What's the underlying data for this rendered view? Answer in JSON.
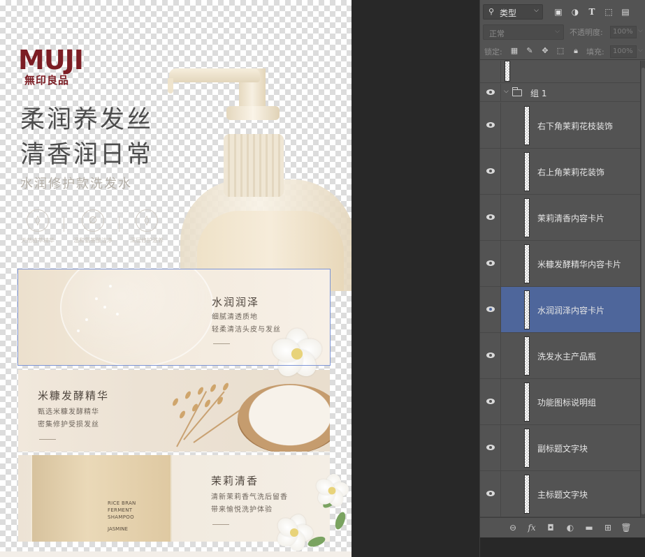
{
  "poster": {
    "logo": {
      "main": "MUJI",
      "sub": "無印良品"
    },
    "headline": {
      "line1": "柔润养发丝",
      "line2": "清香润日常"
    },
    "subtitle": "水润修护款洗发水",
    "features": [
      {
        "icon": "droplet-icon",
        "glyph": "◊",
        "label": "天然植萃精华"
      },
      {
        "icon": "leaf-icon",
        "glyph": "∅",
        "label": "温和氨基酸洁净"
      },
      {
        "icon": "water-drop-icon",
        "glyph": "◊",
        "label": "深层修护滋养"
      }
    ],
    "cards": [
      {
        "title": "水润润泽",
        "desc1": "细腻清透质地",
        "desc2": "轻柔清洁头皮与发丝"
      },
      {
        "title": "米糠发酵精华",
        "desc1": "甄选米糠发酵精华",
        "desc2": "密集修护受损发丝"
      },
      {
        "title": "茉莉清香",
        "desc1": "清新茉莉香气洗后留香",
        "desc2": "带来愉悦洗护体验"
      }
    ],
    "bottle_label": {
      "lines": [
        "RICE BRAN",
        "FERMENT",
        "SHAMPOO"
      ],
      "variant": "JASMINE"
    },
    "colors": {
      "brand": "#7c1d24",
      "selection": "#7d95d6"
    }
  },
  "layers_panel": {
    "filter": {
      "label": "类型",
      "icon": "search-icon"
    },
    "filter_icons": [
      "image-filter-icon",
      "adjustment-filter-icon",
      "type-filter-icon",
      "shape-filter-icon",
      "smart-object-filter-icon"
    ],
    "blend_mode": "正常",
    "opacity": {
      "label": "不透明度:",
      "value": "100%"
    },
    "lock": {
      "label": "锁定:"
    },
    "fill": {
      "label": "填充:",
      "value": "100%"
    },
    "group": {
      "name": "组 1"
    },
    "layers": [
      {
        "name": "右下角茉莉花枝装饰",
        "selected": false
      },
      {
        "name": "右上角茉莉花装饰",
        "selected": false
      },
      {
        "name": "茉莉清香内容卡片",
        "selected": false
      },
      {
        "name": "米糠发酵精华内容卡片",
        "selected": false
      },
      {
        "name": "水润润泽内容卡片",
        "selected": true
      },
      {
        "name": "洗发水主产品瓶",
        "selected": false
      },
      {
        "name": "功能图标说明组",
        "selected": false
      },
      {
        "name": "副标题文字块",
        "selected": false
      },
      {
        "name": "主标题文字块",
        "selected": false
      }
    ],
    "colors": {
      "panel": "#535353",
      "selected_row": "#4e669b"
    }
  }
}
